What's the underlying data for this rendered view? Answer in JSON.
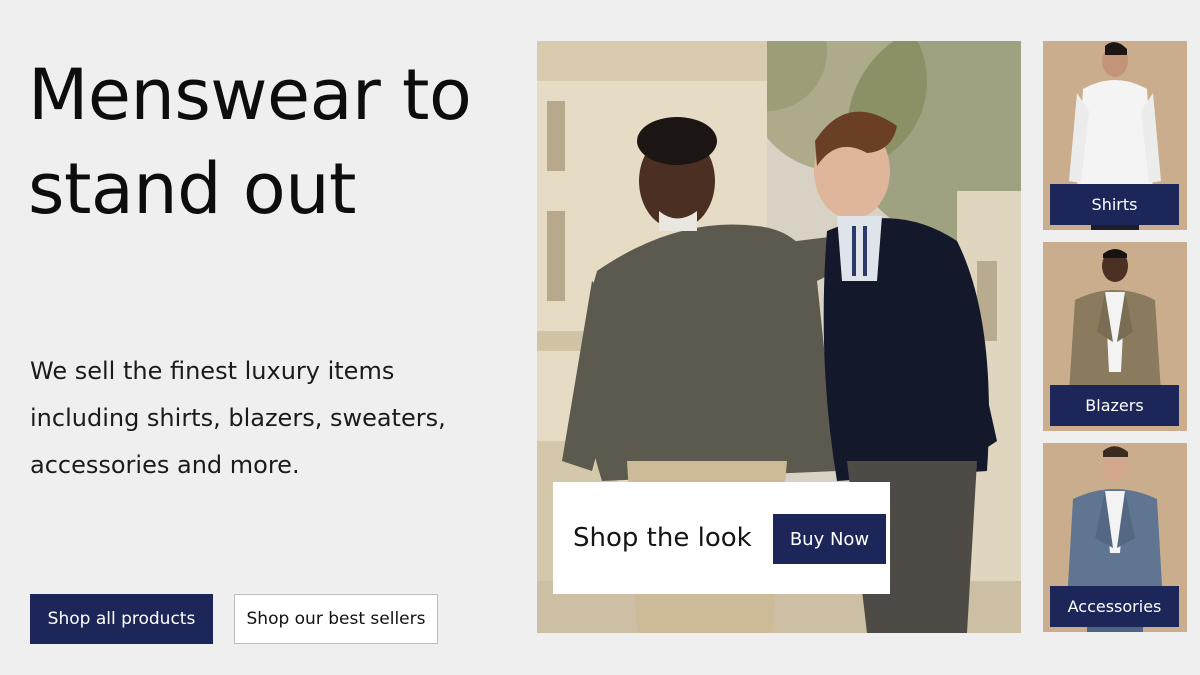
{
  "hero": {
    "title_line1": "Menswear to",
    "title_line2": "stand out",
    "description": "We sell the finest luxury items including shirts, blazers, sweaters, accessories and more."
  },
  "buttons": {
    "shop_all": "Shop all products",
    "best_sellers": "Shop our best sellers"
  },
  "feature": {
    "card_label": "Shop the look",
    "buy_now": "Buy Now"
  },
  "categories": [
    {
      "label": "Shirts"
    },
    {
      "label": "Blazers"
    },
    {
      "label": "Accessories"
    }
  ],
  "colors": {
    "accent_navy": "#1d2659",
    "background": "#efefef",
    "tile_background": "#c9ae8e"
  }
}
